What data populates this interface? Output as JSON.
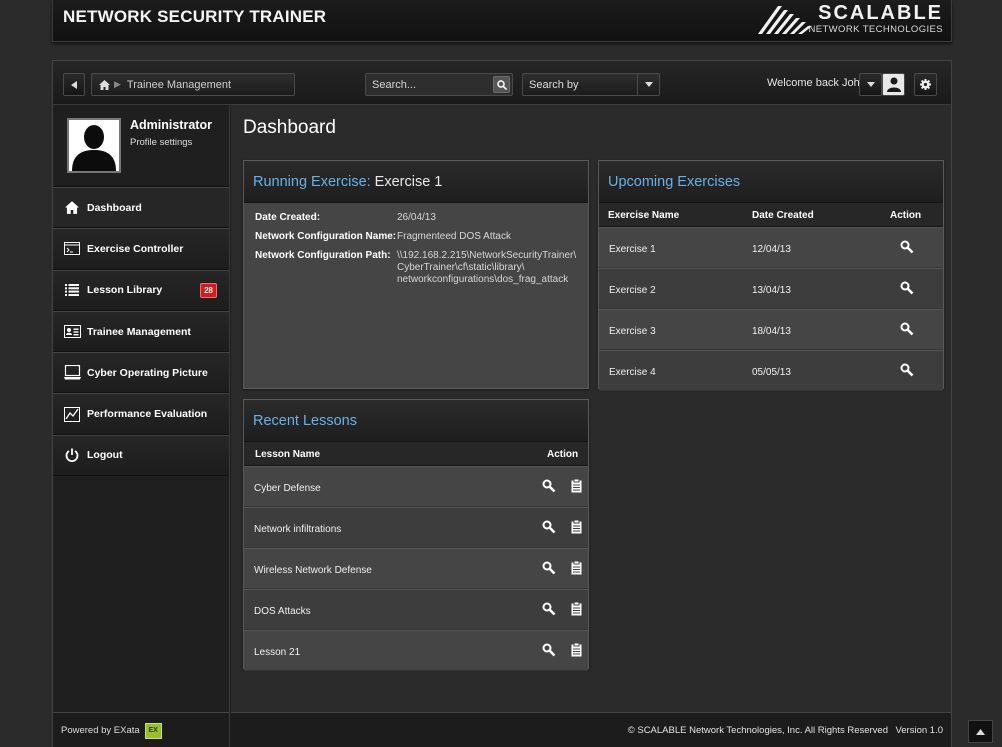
{
  "app": {
    "title": "NETWORK SECURITY TRAINER",
    "brand_name": "SCALABLE",
    "brand_sub": "NETWORK TECHNOLOGIES"
  },
  "toolbar": {
    "breadcrumb": "Trainee Management",
    "search_placeholder": "Search...",
    "search_by": "Search by",
    "welcome": "Welcome back John"
  },
  "profile": {
    "name": "Administrator",
    "settings": "Profile settings"
  },
  "nav": {
    "items": [
      {
        "label": "Dashboard",
        "icon": "home-icon"
      },
      {
        "label": "Exercise Controller",
        "icon": "terminal-icon"
      },
      {
        "label": "Lesson Library",
        "icon": "list-icon",
        "badge": "28"
      },
      {
        "label": "Trainee Management",
        "icon": "id-card-icon"
      },
      {
        "label": "Cyber Operating Picture",
        "icon": "monitor-icon"
      },
      {
        "label": "Performance Evaluation",
        "icon": "chart-icon"
      },
      {
        "label": "Logout",
        "icon": "power-icon"
      }
    ]
  },
  "main": {
    "title": "Dashboard"
  },
  "running": {
    "title_accent": "Running Exercise:",
    "title_rest": "Exercise 1",
    "fields": [
      {
        "label": "Date Created:",
        "value": "26/04/13"
      },
      {
        "label": "Network Configuration Name:",
        "value": "Fragmenteed DOS Attack"
      },
      {
        "label": "Network Configuration Path:",
        "value": "\\\\192.168.2.215\\NetworkSecurityTrainer\\ CyberTrainer\\cf\\static\\library\\ networkconfigurations\\dos_frag_attack"
      }
    ]
  },
  "upcoming": {
    "title": "Upcoming Exercises",
    "headers": {
      "name": "Exercise Name",
      "date": "Date Created",
      "action": "Action"
    },
    "rows": [
      {
        "name": "Exercise 1",
        "date": "12/04/13"
      },
      {
        "name": "Exercise 2",
        "date": "13/04/13"
      },
      {
        "name": "Exercise 3",
        "date": "18/04/13"
      },
      {
        "name": "Exercise 4",
        "date": "05/05/13"
      }
    ]
  },
  "lessons": {
    "title": "Recent Lessons",
    "headers": {
      "name": "Lesson Name",
      "action": "Action"
    },
    "rows": [
      {
        "name": "Cyber Defense"
      },
      {
        "name": "Network infiltrations"
      },
      {
        "name": "Wireless Network Defense"
      },
      {
        "name": "DOS Attacks"
      },
      {
        "name": "Lesson 21"
      }
    ]
  },
  "footer": {
    "powered_by": "Powered by EXata",
    "exata_logo": "EX",
    "copyright": "© SCALABLE Network Technologies, Inc. All Rights Reserved",
    "version": "Version 1.0"
  },
  "colors": {
    "accent": "#6ab0e6",
    "badge": "#d31d1d"
  }
}
